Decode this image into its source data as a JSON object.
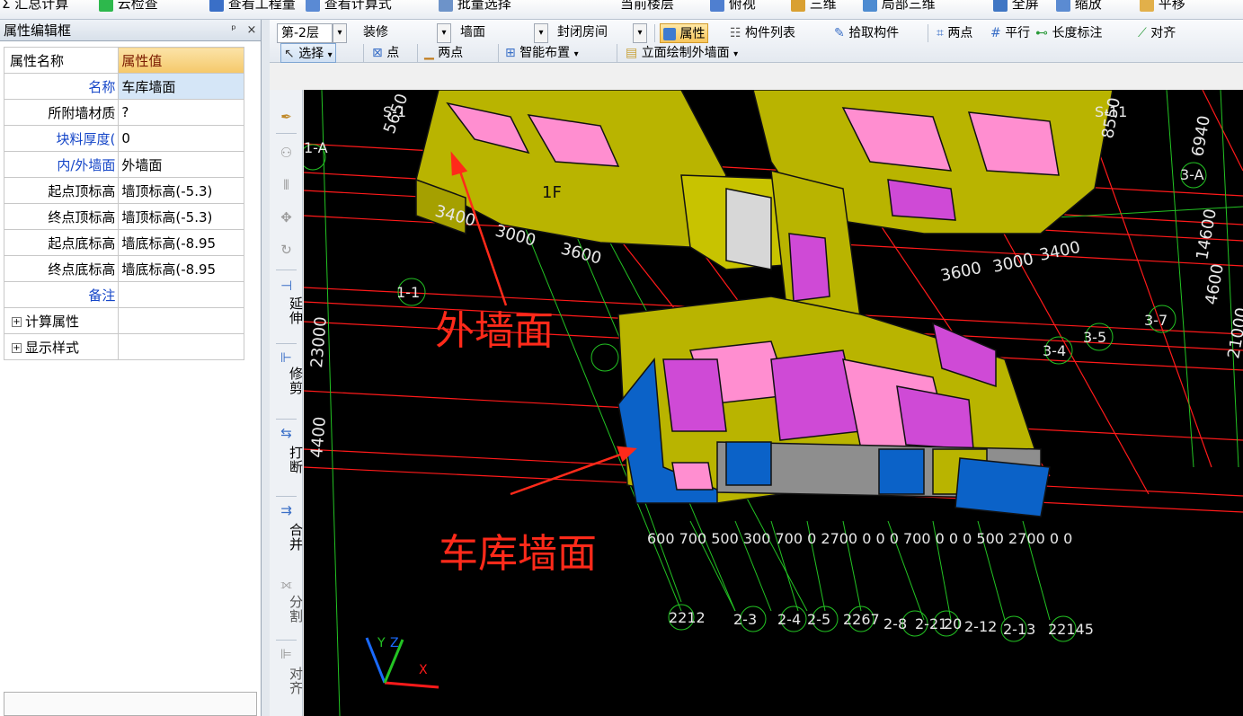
{
  "top_toolbar": {
    "items": [
      "Σ 汇总计算",
      "云检查",
      "查看工程量",
      "查看计算式",
      "批量选择",
      "当前楼层",
      "俯视",
      "三维",
      "局部三维",
      "全屏",
      "缩放",
      "平移"
    ]
  },
  "property_panel": {
    "title": "属性编辑框",
    "pin_glyph": "ᵖ",
    "close_glyph": "×",
    "col_name": "属性名称",
    "col_value": "属性值",
    "rows": [
      {
        "name": "名称",
        "value": "车库墙面"
      },
      {
        "name": "所附墙材质",
        "value": "?"
      },
      {
        "name": "块料厚度(",
        "value": "0"
      },
      {
        "name": "内/外墙面",
        "value": "外墙面"
      },
      {
        "name": "起点顶标高",
        "value": "墙顶标高(-5.3)"
      },
      {
        "name": "终点顶标高",
        "value": "墙顶标高(-5.3)"
      },
      {
        "name": "起点底标高",
        "value": "墙底标高(-8.95"
      },
      {
        "name": "终点底标高",
        "value": "墙底标高(-8.95"
      },
      {
        "name": "备注",
        "value": ""
      }
    ],
    "groups": [
      "计算属性",
      "显示样式"
    ]
  },
  "toolbar_row1": {
    "floor": "第-2层",
    "category": "装修",
    "type": "墙面",
    "room": "封闭房间",
    "properties": "属性",
    "component_list": "构件列表",
    "pick_component": "拾取构件",
    "two_points": "两点",
    "parallel": "平行",
    "length_dim": "长度标注",
    "align": "对齐"
  },
  "toolbar_row2": {
    "select": "选择",
    "point": "点",
    "two_points": "两点",
    "smart_layout": "智能布置",
    "elevation_draw": "立面绘制外墙面"
  },
  "vertical_toolbar": {
    "extend": "延伸",
    "trim": "修剪",
    "break": "打断",
    "merge": "合并",
    "split": "分割",
    "align": "对齐"
  },
  "viewport": {
    "annotation_outer": "外墙面",
    "annotation_garage": "车库墙面",
    "annot_color": "#ff2a1a",
    "axis_labels_x": [
      "2212",
      "2-3",
      "2-4",
      "2-5",
      "2267",
      "2-8",
      "2-21",
      "20",
      "2-12",
      "2-13",
      "22145"
    ],
    "axis_labels_y": [
      "1-A",
      "3-A",
      "1-1",
      "3-7",
      "3-4",
      "3-5",
      "S-1",
      "S-11"
    ],
    "dims_top_left": [
      "3400",
      "3000",
      "3600"
    ],
    "dims_top_right": [
      "3600",
      "3000",
      "3400"
    ],
    "dims_bottom": "600 700 500 300 700 0 2700 0 0 0 700 0 0 0 500 2700 0 0",
    "dims_right": [
      "6940",
      "14600",
      "4600",
      "21000"
    ],
    "dims_left": [
      "4400",
      "23000"
    ],
    "dims_misc": [
      "5650",
      "8550",
      "1F"
    ],
    "axis_x": "X",
    "axis_y": "Y",
    "axis_z": "Z"
  }
}
